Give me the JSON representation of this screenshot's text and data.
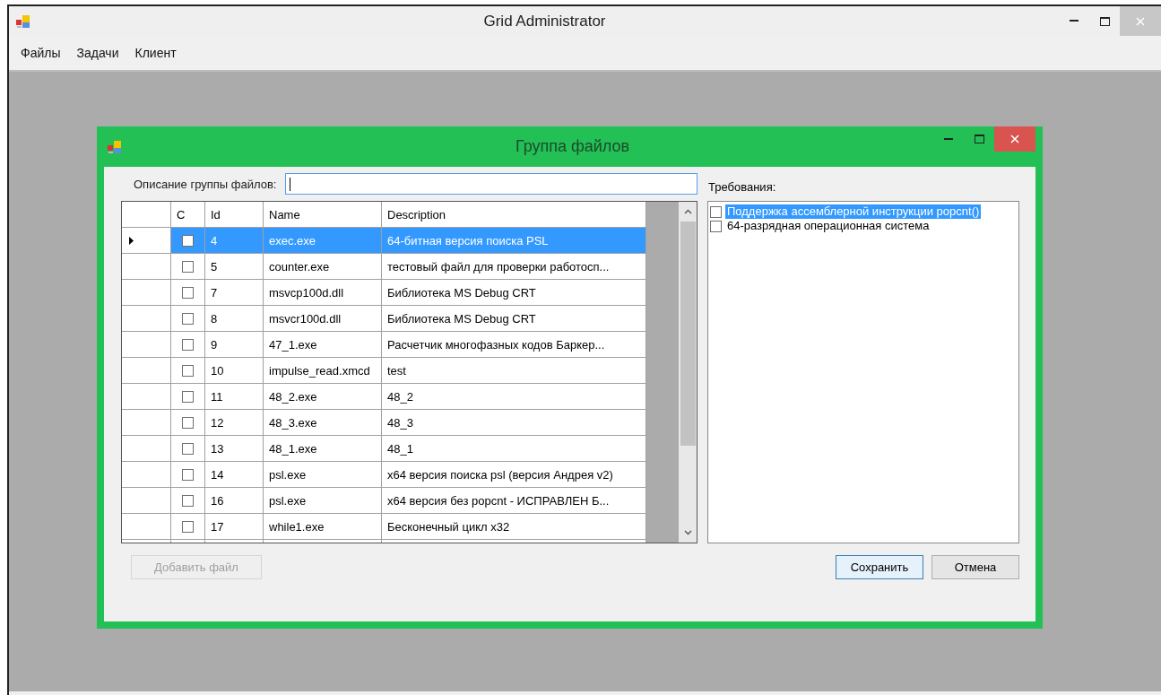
{
  "window": {
    "title": "Grid Administrator"
  },
  "menu": [
    {
      "label": "Файлы"
    },
    {
      "label": "Задачи"
    },
    {
      "label": "Клиент"
    }
  ],
  "dialog": {
    "title": "Группа файлов",
    "description_field": {
      "label": "Описание группы файлов:"
    },
    "grid": {
      "columns": [
        "C",
        "Id",
        "Name",
        "Description"
      ],
      "rows": [
        {
          "checked": false,
          "selected": true,
          "id": "4",
          "name": "exec.exe",
          "description": "64-битная версия поиска PSL"
        },
        {
          "checked": false,
          "selected": false,
          "id": "5",
          "name": "counter.exe",
          "description": "тестовый файл для проверки работосп..."
        },
        {
          "checked": false,
          "selected": false,
          "id": "7",
          "name": "msvcp100d.dll",
          "description": "Библиотека MS Debug CRT"
        },
        {
          "checked": false,
          "selected": false,
          "id": "8",
          "name": "msvcr100d.dll",
          "description": "Библиотека MS Debug CRT"
        },
        {
          "checked": false,
          "selected": false,
          "id": "9",
          "name": "47_1.exe",
          "description": "Расчетчик многофазных кодов Баркер..."
        },
        {
          "checked": false,
          "selected": false,
          "id": "10",
          "name": "impulse_read.xmcd",
          "description": "test"
        },
        {
          "checked": false,
          "selected": false,
          "id": "11",
          "name": "48_2.exe",
          "description": "48_2"
        },
        {
          "checked": false,
          "selected": false,
          "id": "12",
          "name": "48_3.exe",
          "description": "48_3"
        },
        {
          "checked": false,
          "selected": false,
          "id": "13",
          "name": "48_1.exe",
          "description": "48_1"
        },
        {
          "checked": false,
          "selected": false,
          "id": "14",
          "name": "psl.exe",
          "description": "x64 версия поиска psl (версия Андрея v2)"
        },
        {
          "checked": false,
          "selected": false,
          "id": "16",
          "name": "psl.exe",
          "description": "x64 версия без popcnt - ИСПРАВЛЕН Б..."
        },
        {
          "checked": false,
          "selected": false,
          "id": "17",
          "name": "while1.exe",
          "description": "Бесконечный цикл x32"
        }
      ]
    },
    "requirements": {
      "label": "Требования:",
      "items": [
        {
          "label": "Поддержка ассемблерной инструкции popcnt()",
          "checked": false,
          "selected": true
        },
        {
          "label": "64-разрядная операционная система",
          "checked": false,
          "selected": false
        }
      ]
    },
    "buttons": [
      {
        "label": "Добавить файл",
        "disabled": true,
        "focused": false,
        "kind": "left"
      },
      {
        "label": "Сохранить",
        "disabled": false,
        "focused": true,
        "kind": "right"
      },
      {
        "label": "Отмена",
        "disabled": false,
        "focused": false,
        "kind": "right"
      }
    ]
  }
}
